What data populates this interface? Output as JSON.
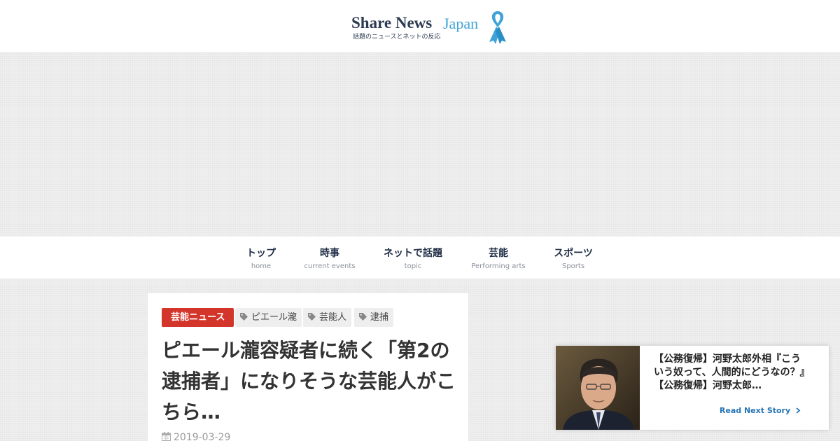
{
  "header": {
    "logo": {
      "share": "Share News",
      "japan": "Japan",
      "tagline": "話題のニュースとネットの反応"
    }
  },
  "nav": {
    "items": [
      {
        "label": "トップ",
        "sub": "home"
      },
      {
        "label": "時事",
        "sub": "current events"
      },
      {
        "label": "ネットで話題",
        "sub": "topic"
      },
      {
        "label": "芸能",
        "sub": "Performing arts"
      },
      {
        "label": "スポーツ",
        "sub": "Sports"
      }
    ]
  },
  "article": {
    "category": "芸能ニュース",
    "tags": [
      "ピエール瀧",
      "芸能人",
      "逮捕"
    ],
    "title": "ピエール瀧容疑者に続く「第2の逮捕者」になりそうな芸能人がこちら…",
    "date": "2019-03-29"
  },
  "next_story": {
    "title": "【公務復帰】河野太郎外相『こういう奴って、人間的にどうなの？』【公務復帰】河野太郎…",
    "link_label": "Read Next Story",
    "link_icon": "chevron-right-icon"
  },
  "colors": {
    "accent_red": "#d3352b",
    "logo_blue": "#3fa3d8",
    "link_blue": "#2574b5",
    "navy": "#2d3b52"
  }
}
